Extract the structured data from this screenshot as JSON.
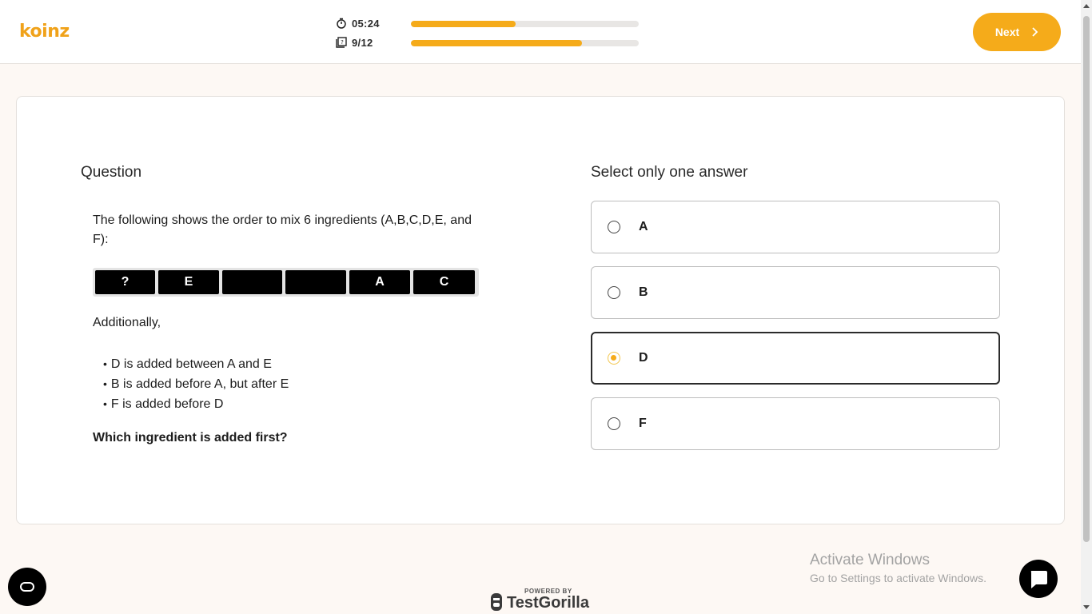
{
  "header": {
    "logo_text": "koinz",
    "timer": "05:24",
    "timer_progress": 0.46,
    "question_counter": "9/12",
    "question_progress": 0.75,
    "next_label": "Next"
  },
  "question": {
    "heading": "Question",
    "intro": "The following shows the order to mix 6 ingredients (A,B,C,D,E, and F):",
    "sequence": [
      "?",
      "E",
      "",
      "",
      "A",
      "C"
    ],
    "additionally": "Additionally,",
    "rules": [
      "D is added between A and E",
      "B is added before A, but after E",
      "F is added before D"
    ],
    "prompt": "Which ingredient is added first?"
  },
  "answers": {
    "heading": "Select only one answer",
    "options": [
      {
        "label": "A",
        "selected": false
      },
      {
        "label": "B",
        "selected": false
      },
      {
        "label": "D",
        "selected": true
      },
      {
        "label": "F",
        "selected": false
      }
    ]
  },
  "footer": {
    "powered_by": "POWERED BY",
    "brand": "TestGorilla",
    "activate_title": "Activate Windows",
    "activate_sub": "Go to Settings to activate Windows."
  },
  "colors": {
    "accent": "#f5ab1a",
    "background": "#fdf8f4"
  },
  "icons": {
    "timer": "stopwatch-icon",
    "counter": "questions-icon",
    "next": "chevron-right-icon",
    "cookie": "cookie-settings-icon",
    "chat": "chat-icon"
  }
}
